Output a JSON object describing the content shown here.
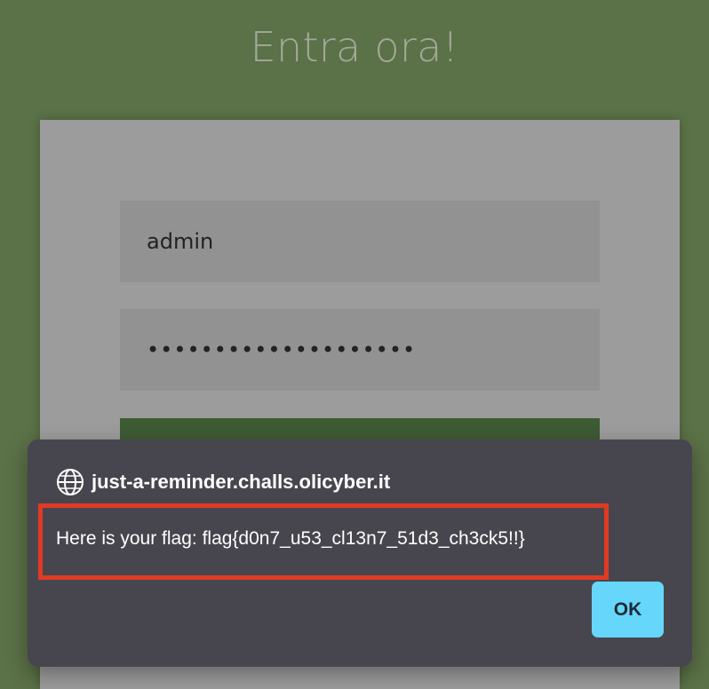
{
  "page": {
    "title": "Entra ora!"
  },
  "login_form": {
    "username_value": "admin",
    "password_value": "••••••••••••••••••••"
  },
  "alert_dialog": {
    "origin": "just-a-reminder.challs.olicyber.it",
    "message": "Here is your flag: flag{d0n7_u53_cl13n7_51d3_ch3ck5!!}",
    "ok_label": "OK",
    "origin_icon": "globe-icon"
  },
  "colors": {
    "background": "#5b7147",
    "card": "#9c9c9c",
    "dialog": "#47464f",
    "ok_button": "#67d6fb",
    "highlight": "#e13a24",
    "submit_button": "#3e5b33"
  }
}
